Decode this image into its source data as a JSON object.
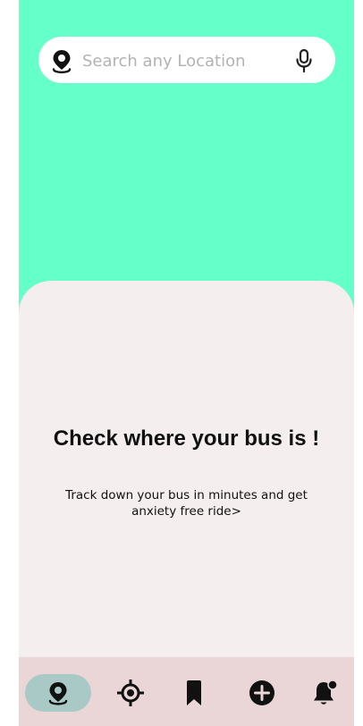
{
  "search": {
    "placeholder": "Search any Location",
    "value": ""
  },
  "sheet": {
    "title": "Check where your bus is !",
    "description": "Track down your bus in minutes and get anxiety free ride>"
  },
  "nav": {
    "items": [
      {
        "icon": "location-pin-icon",
        "active": true
      },
      {
        "icon": "crosshair-icon",
        "active": false
      },
      {
        "icon": "bookmark-icon",
        "active": false
      },
      {
        "icon": "add-circle-icon",
        "active": false
      },
      {
        "icon": "notification-bell-icon",
        "active": false
      }
    ]
  },
  "colors": {
    "map_background": "#65ffc9",
    "sheet_background": "#f4eeee",
    "nav_background": "#ead6d6",
    "nav_active_pill": "#a9c9c6"
  }
}
